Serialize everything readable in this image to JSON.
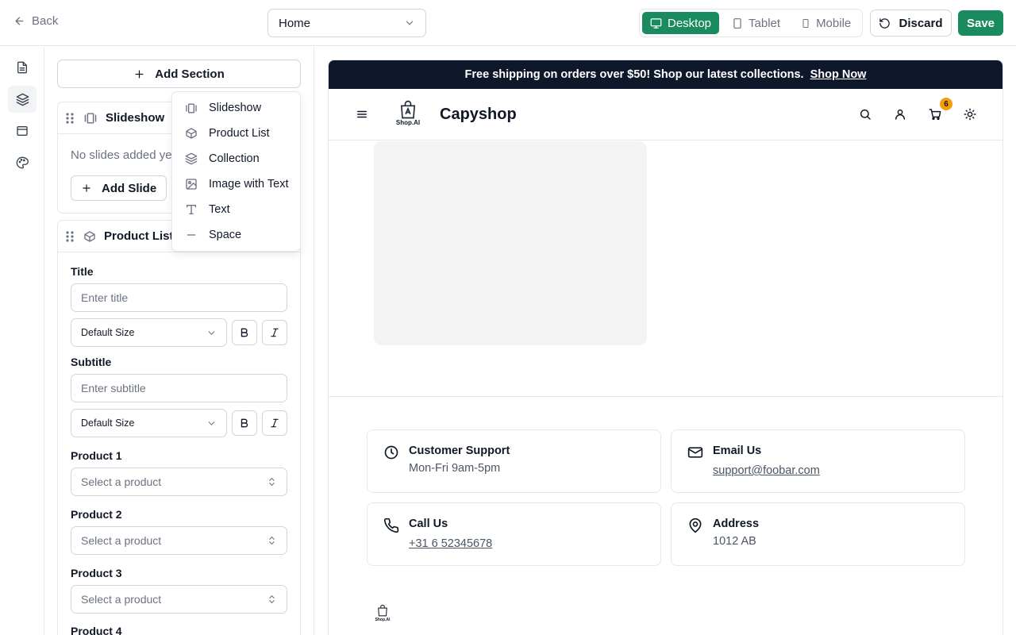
{
  "topbar": {
    "back_label": "Back",
    "page_select_value": "Home",
    "devices": [
      "Desktop",
      "Tablet",
      "Mobile"
    ],
    "discard_label": "Discard",
    "save_label": "Save"
  },
  "colors": {
    "accent": "#1a8b5e",
    "announce_bg": "#0f172a",
    "badge": "#f59e0b"
  },
  "rail": {
    "icons": [
      "file-icon",
      "layers-icon",
      "layout-icon",
      "palette-icon"
    ]
  },
  "panel": {
    "add_section_label": "Add Section",
    "slideshow": {
      "title": "Slideshow",
      "empty_text": "No slides added yet",
      "add_slide_label": "Add Slide"
    },
    "product_list": {
      "title": "Product List",
      "title_label": "Title",
      "title_placeholder": "Enter title",
      "title_size": "Default Size",
      "subtitle_label": "Subtitle",
      "subtitle_placeholder": "Enter subtitle",
      "subtitle_size": "Default Size",
      "products": [
        {
          "label": "Product 1",
          "placeholder": "Select a product"
        },
        {
          "label": "Product 2",
          "placeholder": "Select a product"
        },
        {
          "label": "Product 3",
          "placeholder": "Select a product"
        },
        {
          "label": "Product 4",
          "placeholder": ""
        }
      ]
    }
  },
  "dropdown": {
    "items": [
      "Slideshow",
      "Product List",
      "Collection",
      "Image with Text",
      "Text",
      "Space"
    ]
  },
  "preview": {
    "announcement": "Free shipping on orders over $50! Shop our latest collections.",
    "announcement_link": "Shop Now",
    "brand_name": "Capyshop",
    "logo_text": "Shop.AI",
    "cart_count": "6",
    "contacts": [
      {
        "title": "Customer Support",
        "value": "Mon-Fri 9am-5pm"
      },
      {
        "title": "Email Us",
        "value": "support@foobar.com"
      },
      {
        "title": "Call Us",
        "value": "+31 6 52345678"
      },
      {
        "title": "Address",
        "value": "1012 AB"
      }
    ]
  }
}
